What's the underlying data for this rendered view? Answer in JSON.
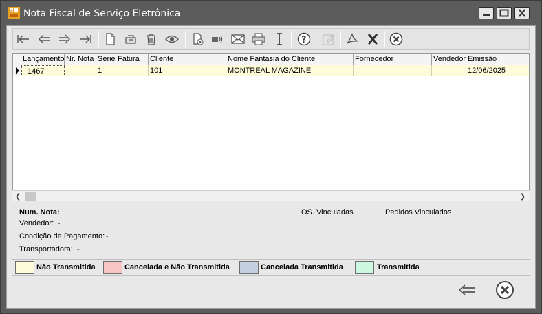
{
  "window": {
    "title": "Nota Fiscal de Serviço Eletrônica",
    "controls": [
      "minimize-icon",
      "maximize-icon",
      "close-icon"
    ]
  },
  "toolbar": {
    "icons": [
      "first-record-icon",
      "previous-record-icon",
      "next-record-icon",
      "last-record-icon",
      "new-document-icon",
      "inbox-icon",
      "trash-icon",
      "eye-icon",
      "cancel-document-icon",
      "transmit-icon",
      "envelope-icon",
      "print-icon",
      "cursor-icon",
      "help-icon",
      "edit-icon",
      "pdf-icon",
      "excel-icon",
      "close-circle-icon"
    ]
  },
  "grid": {
    "columns": [
      "Lançamento",
      "Nr. Nota",
      "Série",
      "Fatura",
      "Cliente",
      "Nome Fantasia do Cliente",
      "Fornecedor",
      "Vendedor",
      "Emissão"
    ],
    "rows": [
      {
        "lancamento": "1467",
        "nr_nota": "",
        "serie": "1",
        "fatura": "",
        "cliente": "101",
        "nome_fantasia": "MONTREAL MAGAZINE",
        "fornecedor": "",
        "vendedor": "",
        "emissao": "12/06/2025"
      }
    ]
  },
  "details": {
    "num_nota_label": "Num. Nota:",
    "vendedor_label": "Vendedor:",
    "vendedor_value": "-",
    "condicao_label": "Condição de Pagamento:",
    "condicao_value": "-",
    "transportadora_label": "Transportadora:",
    "transportadora_value": "-",
    "os_vinculadas": "OS. Vinculadas",
    "pedidos_vinculados": "Pedidos Vinculados"
  },
  "legend": [
    {
      "label": "Não Transmitida",
      "color": "#fdfbd9"
    },
    {
      "label": "Cancelada e Não Transmitida",
      "color": "#f8c4c4"
    },
    {
      "label": "Cancelada Transmitida",
      "color": "#c4cfe0"
    },
    {
      "label": "Transmitida",
      "color": "#ccf8e0"
    }
  ],
  "footer": {
    "buttons": [
      "back-arrow-icon",
      "close-circle-icon"
    ]
  }
}
